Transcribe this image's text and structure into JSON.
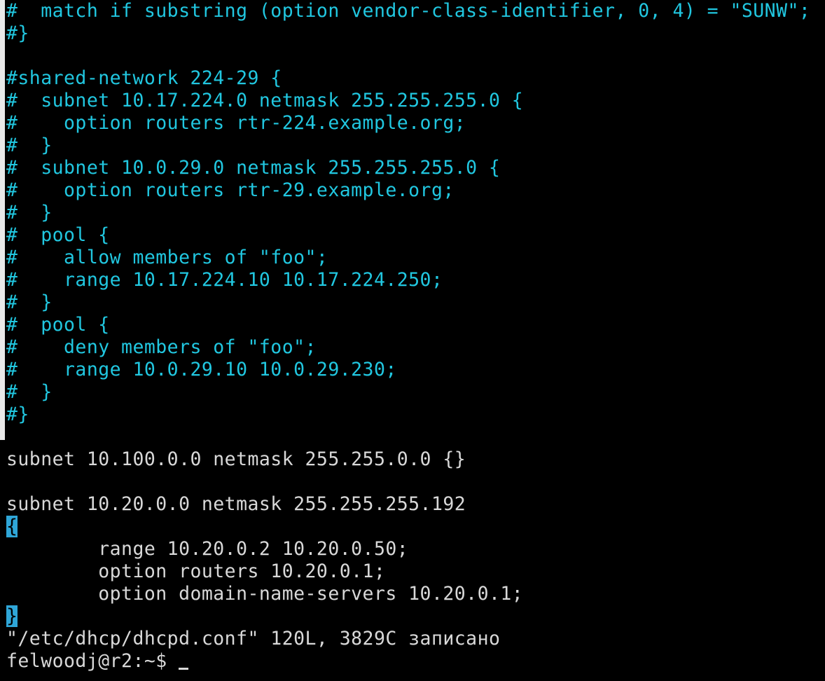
{
  "terminal": {
    "lines": [
      {
        "text": "#  match if substring (option vendor-class-identifier, 0, 4) = \"SUNW\";",
        "color": "#21c7e0"
      },
      {
        "text": "#}",
        "color": "#21c7e0"
      },
      {
        "text": "",
        "color": "#21c7e0"
      },
      {
        "text": "#shared-network 224-29 {",
        "color": "#21c7e0"
      },
      {
        "text": "#  subnet 10.17.224.0 netmask 255.255.255.0 {",
        "color": "#21c7e0"
      },
      {
        "text": "#    option routers rtr-224.example.org;",
        "color": "#21c7e0"
      },
      {
        "text": "#  }",
        "color": "#21c7e0"
      },
      {
        "text": "#  subnet 10.0.29.0 netmask 255.255.255.0 {",
        "color": "#21c7e0"
      },
      {
        "text": "#    option routers rtr-29.example.org;",
        "color": "#21c7e0"
      },
      {
        "text": "#  }",
        "color": "#21c7e0"
      },
      {
        "text": "#  pool {",
        "color": "#21c7e0"
      },
      {
        "text": "#    allow members of \"foo\";",
        "color": "#21c7e0"
      },
      {
        "text": "#    range 10.17.224.10 10.17.224.250;",
        "color": "#21c7e0"
      },
      {
        "text": "#  }",
        "color": "#21c7e0"
      },
      {
        "text": "#  pool {",
        "color": "#21c7e0"
      },
      {
        "text": "#    deny members of \"foo\";",
        "color": "#21c7e0"
      },
      {
        "text": "#    range 10.0.29.10 10.0.29.230;",
        "color": "#21c7e0"
      },
      {
        "text": "#  }",
        "color": "#21c7e0"
      },
      {
        "text": "#}",
        "color": "#21c7e0"
      },
      {
        "text": "",
        "color": "#d8d8d8"
      },
      {
        "text": "subnet 10.100.0.0 netmask 255.255.0.0 {}",
        "color": "#d8d8d8"
      },
      {
        "text": "",
        "color": "#d8d8d8"
      },
      {
        "text": "subnet 10.20.0.0 netmask 255.255.255.192",
        "color": "#d8d8d8"
      },
      {
        "text": "{",
        "color": "#d8d8d8",
        "highlight": true
      },
      {
        "text": "        range 10.20.0.2 10.20.0.50;",
        "color": "#d8d8d8"
      },
      {
        "text": "        option routers 10.20.0.1;",
        "color": "#d8d8d8"
      },
      {
        "text": "        option domain-name-servers 10.20.0.1;",
        "color": "#d8d8d8"
      },
      {
        "text": "}",
        "color": "#d8d8d8",
        "highlight": true
      },
      {
        "text": "\"/etc/dhcp/dhcpd.conf\" 120L, 3829C записано",
        "color": "#d8d8d8"
      },
      {
        "text": "felwoodj@r2:~$ ",
        "color": "#d8d8d8",
        "cursor": true
      }
    ],
    "highlight_color": "#2fa6d8"
  }
}
